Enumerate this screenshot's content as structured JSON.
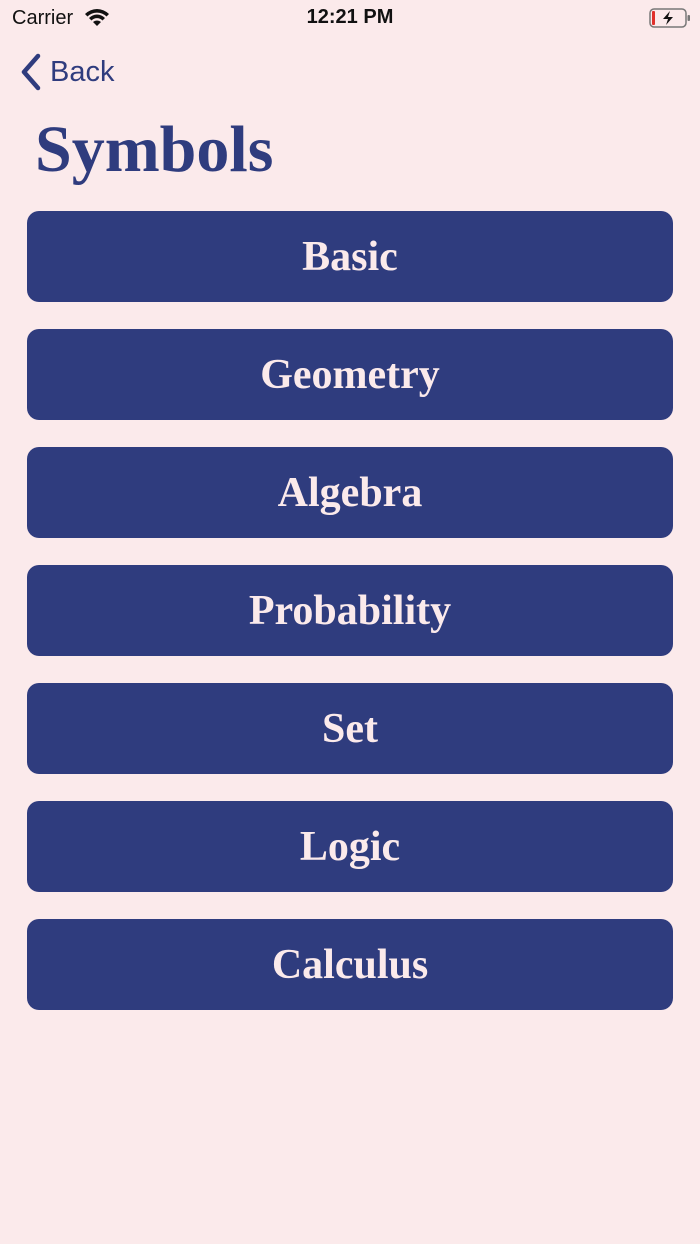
{
  "status_bar": {
    "carrier": "Carrier",
    "time": "12:21 PM",
    "wifi_icon": "wifi-icon",
    "battery_icon": "battery-charging-icon"
  },
  "nav": {
    "back_label": "Back",
    "back_icon": "chevron-left-icon"
  },
  "page": {
    "title": "Symbols"
  },
  "menu": {
    "items": [
      {
        "label": "Basic"
      },
      {
        "label": "Geometry"
      },
      {
        "label": "Algebra"
      },
      {
        "label": "Probability"
      },
      {
        "label": "Set"
      },
      {
        "label": "Logic"
      },
      {
        "label": "Calculus"
      }
    ]
  },
  "colors": {
    "background": "#fbeaeb",
    "accent": "#2f3c7e",
    "button_text": "#fbeaeb"
  }
}
